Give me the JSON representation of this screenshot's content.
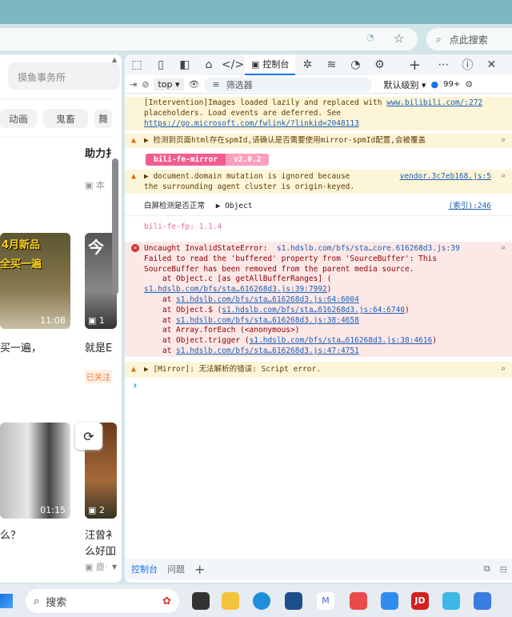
{
  "browser": {
    "search_placeholder": "点此搜索"
  },
  "page": {
    "search_placeholder": "摸鱼事务所",
    "chips": [
      "动画",
      "鬼畜",
      "舞"
    ],
    "cards": [
      {
        "title": "助力扌",
        "meta": "本"
      },
      {
        "thumb_text": [
          "4月新品",
          "全买一遍"
        ],
        "duration": "11:08",
        "title": "买一遍，"
      },
      {
        "thumb_text": [
          "今"
        ],
        "duration": "1",
        "title": "就是E",
        "badge": "已关注"
      },
      {
        "duration": "01:15",
        "title": "么？"
      },
      {
        "duration": "2",
        "title": "汪曾衤",
        "title2": "么好吅",
        "meta": "鹿·"
      }
    ]
  },
  "devtools": {
    "tab_console": "控制台",
    "context": "top",
    "filter_placeholder": "筛选器",
    "level": "默认级别",
    "issue_count": "99+",
    "messages": [
      {
        "type": "warn",
        "lines": [
          "[Intervention]Images loaded lazily and replaced with",
          "placeholders. Load events are deferred. See"
        ],
        "source": "www.bilibili.com/:272",
        "link": "https://go.microsoft.com/fwlink/?linkid=2048113"
      },
      {
        "type": "warn",
        "text": "▶ 检测到页面html存在spmId,请确认是否需要使用mirror-spmId配置,会被覆盖"
      },
      {
        "type": "badge",
        "name": "bili-fe-mirror",
        "version": "v2.0.2"
      },
      {
        "type": "warn",
        "lines": [
          "▶ document.domain mutation is ignored because",
          "the surrounding agent cluster is origin-keyed."
        ],
        "source": "vendor.3c7eb168.js:5"
      },
      {
        "type": "log",
        "text": "白屏检测是否正常",
        "object": "▶ Object",
        "source": "(索引):246"
      },
      {
        "type": "log",
        "text": "bili-fe-fp: 1.1.4"
      },
      {
        "type": "error",
        "head": "Uncaught InvalidStateError:",
        "source": "s1.hdslb.com/bfs/sta…core.616268d3.js:39",
        "lines": [
          "Failed to read the 'buffered' property from 'SourceBuffer': This",
          "SourceBuffer has been removed from the parent media source.",
          "    at Object.c [as getAllBufferRanges] ("
        ],
        "stack": [
          {
            "pre": "",
            "link": "s1.hdslb.com/bfs/sta…616268d3.js:39:7992",
            "post": ")"
          },
          {
            "pre": "    at ",
            "link": "s1.hdslb.com/bfs/sta…616268d3.js:64:6004",
            "post": ""
          },
          {
            "pre": "    at Object.$ (",
            "link": "s1.hdslb.com/bfs/sta…616268d3.js:64:6740",
            "post": ")"
          },
          {
            "pre": "    at ",
            "link": "s1.hdslb.com/bfs/sta…616268d3.js:38:4658",
            "post": ""
          },
          {
            "pre": "    at Array.forEach (<anonymous>)",
            "link": "",
            "post": ""
          },
          {
            "pre": "    at Object.trigger (",
            "link": "s1.hdslb.com/bfs/sta…616268d3.js:38:4616",
            "post": ")"
          },
          {
            "pre": "    at ",
            "link": "s1.hdslb.com/bfs/sta…616268d3.js:47:4751",
            "post": ""
          }
        ]
      },
      {
        "type": "warn",
        "text": "▶ [Mirror]: 无法解析的错误: Script error."
      }
    ],
    "prompt": "›",
    "drawer_tabs": [
      "控制台",
      "问题"
    ]
  },
  "taskbar": {
    "search_label": "搜索"
  }
}
